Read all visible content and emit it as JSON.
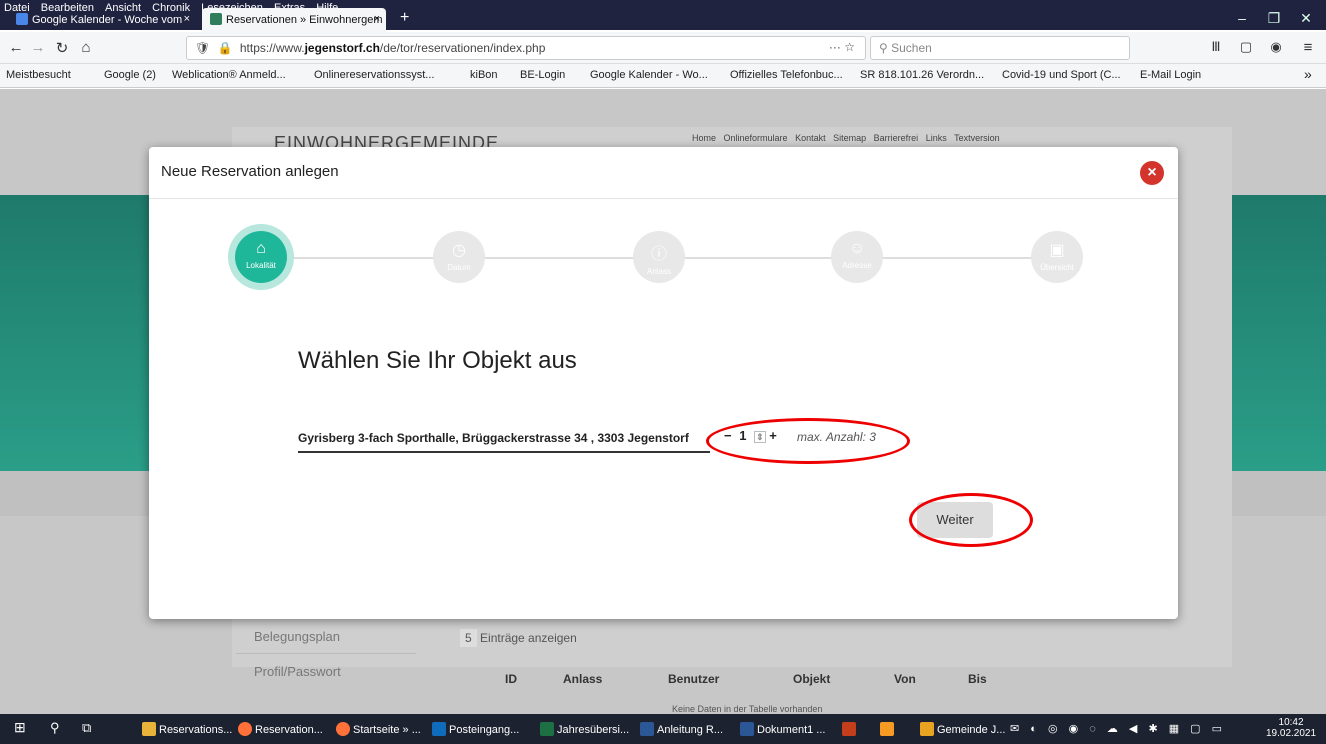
{
  "menu": [
    "Datei",
    "Bearbeiten",
    "Ansicht",
    "Chronik",
    "Lesezeichen",
    "Extras",
    "Hilfe"
  ],
  "tabs": [
    {
      "label": "Google Kalender - Woche vom",
      "close": "×"
    },
    {
      "label": "Reservationen » Einwohnergem",
      "close": "×"
    }
  ],
  "new_tab": "+",
  "url": {
    "prefix": "https://www.",
    "domain": "jegenstorf.ch",
    "path": "/de/tor/reservationen/index.php"
  },
  "search_placeholder": "Suchen",
  "bookmarks": [
    "Meistbesucht",
    "Google (2)",
    "Weblication® Anmeld...",
    "Onlinereservationssyst...",
    "kiBon",
    "BE-Login",
    "Google Kalender - Wo...",
    "Offizielles Telefonbuc...",
    "SR 818.101.26 Verordn...",
    "Covid-19 und Sport (C...",
    "E-Mail Login"
  ],
  "site": {
    "logo": "EINWOHNERGEMEINDE",
    "topnav": [
      "Home",
      "Onlineformulare",
      "Kontakt",
      "Sitemap",
      "Barrierefrei",
      "Links",
      "Textversion"
    ],
    "side": [
      "Belegungsplan",
      "Profil/Passwort"
    ],
    "entries_count": "5",
    "entries_label": "Einträge anzeigen",
    "columns": [
      "ID",
      "Anlass",
      "Benutzer",
      "Objekt",
      "Von",
      "Bis"
    ],
    "empty": "Keine Daten in der Tabelle vorhanden"
  },
  "modal": {
    "title": "Neue Reservation anlegen",
    "close": "×",
    "steps": [
      {
        "label": "Lokalität",
        "icon": "home-icon",
        "active": true
      },
      {
        "label": "Datum",
        "icon": "clock-icon",
        "active": false
      },
      {
        "label": "Anlass",
        "icon": "info-icon",
        "active": false
      },
      {
        "label": "Adresse",
        "icon": "user-icon",
        "active": false
      },
      {
        "label": "Übersicht",
        "icon": "calendar-check-icon",
        "active": false
      }
    ],
    "heading": "Wählen Sie Ihr Objekt aus",
    "object": "Gyrisberg 3-fach Sporthalle, Brüggackerstrasse 34 , 3303 Jegenstorf",
    "qty_minus": "−",
    "qty_value": "1",
    "qty_plus": "+",
    "max": "max. Anzahl: 3",
    "next": "Weiter"
  },
  "taskbar": [
    "Reservations...",
    "Reservation...",
    "Startseite » ...",
    "Posteingang...",
    "Jahresübersi...",
    "Anleitung R...",
    "Dokument1 ...",
    "Gemeinde J..."
  ],
  "clock": {
    "time": "10:42",
    "date": "19.02.2021"
  },
  "colors": {
    "accent": "#1fb79a",
    "chrome": "#202340",
    "close": "#d3352c",
    "annotation": "#e00000"
  }
}
